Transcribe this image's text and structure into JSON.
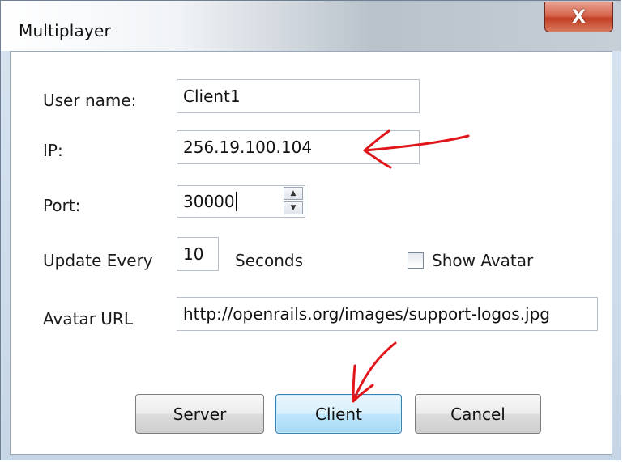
{
  "window": {
    "title": "Multiplayer",
    "close_glyph": "X",
    "close_icon": "close-icon"
  },
  "form": {
    "user_name": {
      "label": "User name:",
      "value": "Client1"
    },
    "ip": {
      "label": "IP:",
      "value": "256.19.100.104"
    },
    "port": {
      "label": "Port:",
      "value": "30000",
      "spinner_icons": [
        "spin-up-icon",
        "spin-down-icon"
      ]
    },
    "update": {
      "label": "Update Every",
      "value": "10",
      "unit": "Seconds"
    },
    "show_avatar": {
      "label": "Show Avatar",
      "checked": false
    },
    "avatar_url": {
      "label": "Avatar URL",
      "value": "http://openrails.org/images/support-logos.jpg"
    }
  },
  "buttons": {
    "server": "Server",
    "client": "Client",
    "cancel": "Cancel"
  },
  "annotation_color": "#e0161a"
}
